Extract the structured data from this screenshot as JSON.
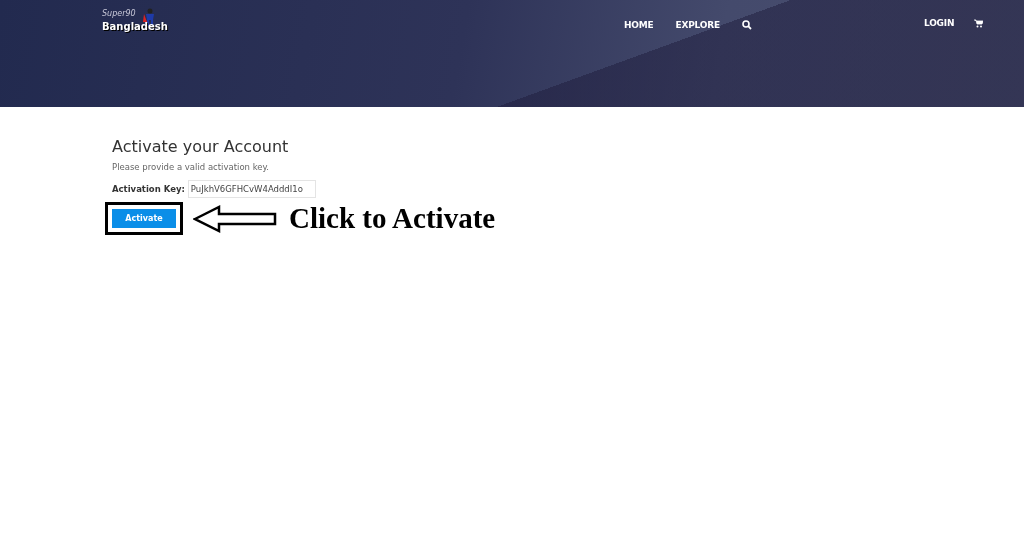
{
  "header": {
    "logo": {
      "top": "Super90",
      "bottom": "Bangladesh"
    },
    "nav": [
      {
        "label": "HOME",
        "kind": "link"
      },
      {
        "label": "EXPLORE",
        "kind": "link"
      },
      {
        "kind": "search"
      }
    ],
    "right": [
      {
        "label": "LOGIN",
        "kind": "link"
      },
      {
        "kind": "cart"
      }
    ]
  },
  "main": {
    "title": "Activate your Account",
    "hint": "Please provide a valid activation key.",
    "field": {
      "label": "Activation Key:",
      "value": "PuJkhV6GFHCvW4AdddI1o"
    },
    "button": "Activate"
  },
  "annotation": {
    "text": "Click to Activate"
  }
}
